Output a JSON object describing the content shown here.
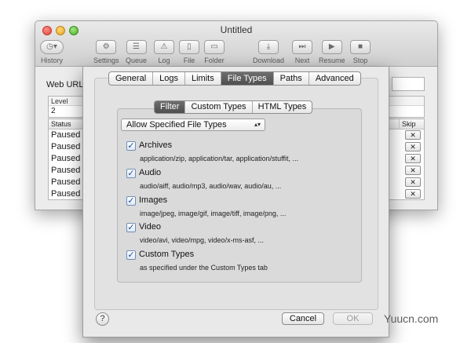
{
  "window": {
    "title": "Untitled"
  },
  "toolbar": {
    "items": [
      {
        "label": "History",
        "icon": "history-icon",
        "glyph": "◷▾"
      },
      {
        "label": "Settings",
        "icon": "gear-icon",
        "glyph": "⚙"
      },
      {
        "label": "Queue",
        "icon": "queue-icon",
        "glyph": "☰"
      },
      {
        "label": "Log",
        "icon": "warning-icon",
        "glyph": "⚠"
      },
      {
        "label": "File",
        "icon": "file-icon",
        "glyph": "▯"
      },
      {
        "label": "Folder",
        "icon": "folder-icon",
        "glyph": "▭"
      },
      {
        "label": "Download",
        "icon": "download-icon",
        "glyph": "⤓"
      },
      {
        "label": "Next",
        "icon": "next-icon",
        "glyph": "⏭"
      },
      {
        "label": "Resume",
        "icon": "play-icon",
        "glyph": "▶"
      },
      {
        "label": "Stop",
        "icon": "stop-icon",
        "glyph": "■"
      }
    ]
  },
  "main": {
    "web_url_label": "Web URL:",
    "level_header": "Level",
    "level_value": "2",
    "table": {
      "columns": {
        "status": "Status",
        "skip": "Skip"
      },
      "rows": [
        "Paused",
        "Paused",
        "Paused",
        "Paused",
        "Paused",
        "Paused"
      ],
      "skip_glyph": "✕"
    }
  },
  "sheet": {
    "tabs": [
      "General",
      "Logs",
      "Limits",
      "File Types",
      "Paths",
      "Advanced"
    ],
    "active_tab": "File Types",
    "subtabs": [
      "Filter",
      "Custom Types",
      "HTML Types"
    ],
    "active_subtab": "Filter",
    "popup": {
      "value": "Allow Specified File Types",
      "arrow": "▴▾"
    },
    "options": [
      {
        "label": "Archives",
        "checked": true,
        "description": "application/zip, application/tar, application/stuffit, ..."
      },
      {
        "label": "Audio",
        "checked": true,
        "description": "audio/aiff, audio/mp3, audio/wav, audio/au, ..."
      },
      {
        "label": "Images",
        "checked": true,
        "description": "image/jpeg, image/gif, image/tiff, image/png, ..."
      },
      {
        "label": "Video",
        "checked": true,
        "description": "video/avi, video/mpg, video/x-ms-asf, ..."
      },
      {
        "label": "Custom Types",
        "checked": true,
        "description": "as specified under the Custom Types tab"
      }
    ],
    "check_glyph": "✓",
    "help_label": "?",
    "cancel_label": "Cancel",
    "ok_label": "OK"
  },
  "watermark": "Yuucn.com"
}
